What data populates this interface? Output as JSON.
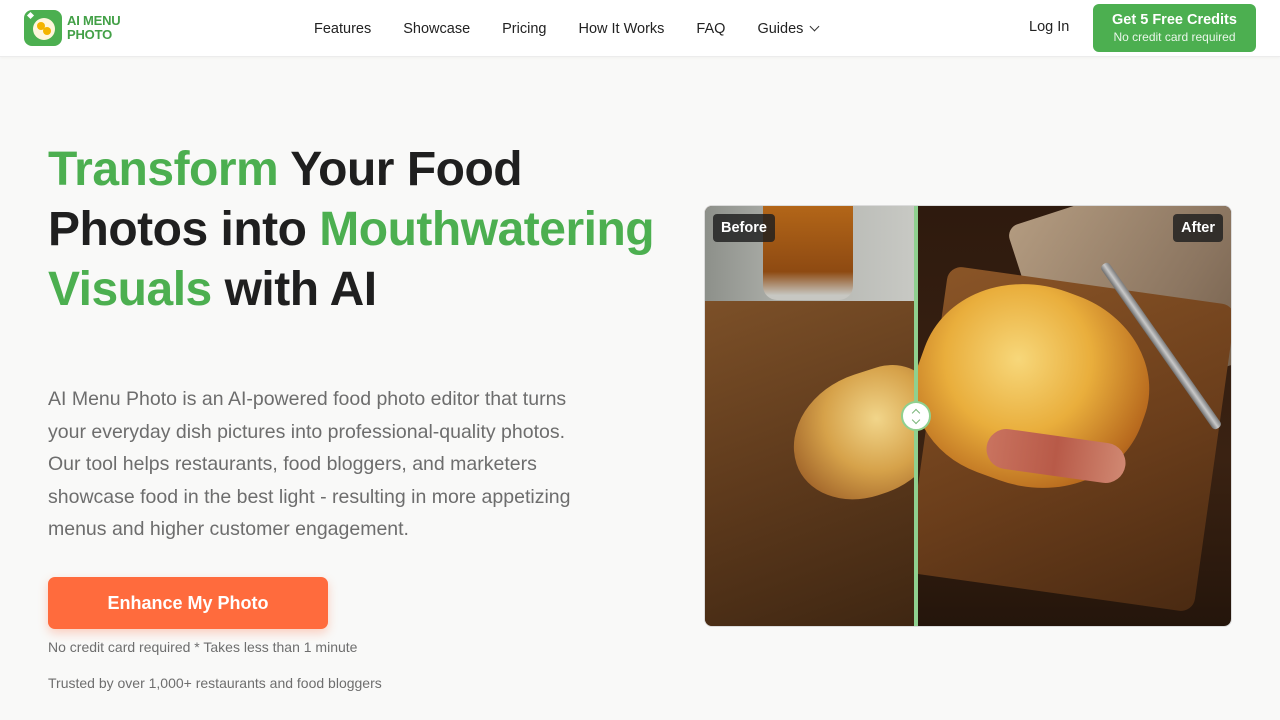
{
  "header": {
    "logo_line1": "AI MENU",
    "logo_line2": "PHOTO",
    "nav": [
      "Features",
      "Showcase",
      "Pricing",
      "How It Works",
      "FAQ",
      "Guides"
    ],
    "login": "Log In",
    "cta_title": "Get 5 Free Credits",
    "cta_subtitle": "No credit card required"
  },
  "hero": {
    "headline_green_1": "Transform",
    "headline_dark_1": " Your Food Photos into ",
    "headline_green_2": "Mouthwatering Visuals",
    "headline_dark_2": " with AI",
    "description": "AI Menu Photo is an AI-powered food photo editor that turns your everyday dish pictures into professional-quality photos. Our tool helps restaurants, food bloggers, and marketers showcase food in the best light - resulting in more appetizing menus and higher customer engagement.",
    "button": "Enhance My Photo",
    "note": "No credit card required * Takes less than 1 minute",
    "trust": "Trusted by over 1,000+ restaurants and food bloggers"
  },
  "comparison": {
    "before_label": "Before",
    "after_label": "After"
  },
  "colors": {
    "brand_green": "#4caf50",
    "cta_orange": "#ff6b3d"
  }
}
